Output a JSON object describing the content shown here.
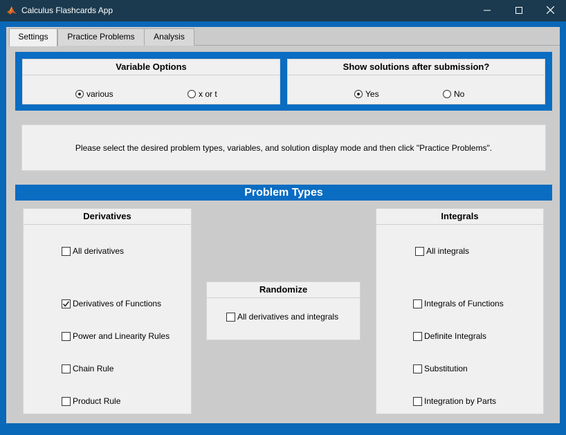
{
  "window": {
    "title": "Calculus Flashcards App",
    "minimize": "—",
    "maximize": "☐",
    "close": "✕"
  },
  "tabs": [
    {
      "label": "Settings",
      "active": true
    },
    {
      "label": "Practice Problems",
      "active": false
    },
    {
      "label": "Analysis",
      "active": false
    }
  ],
  "variable_options": {
    "title": "Variable Options",
    "options": [
      {
        "label": "various",
        "selected": true
      },
      {
        "label": "x or t",
        "selected": false
      }
    ]
  },
  "show_solutions": {
    "title": "Show solutions after submission?",
    "options": [
      {
        "label": "Yes",
        "selected": true
      },
      {
        "label": "No",
        "selected": false
      }
    ]
  },
  "instructions": "Please select the desired problem types, variables, and solution display mode and then click \"Practice Problems\".",
  "problem_types": {
    "title": "Problem Types",
    "derivatives": {
      "title": "Derivatives",
      "items": [
        {
          "label": "All derivatives",
          "checked": false
        },
        {
          "label": "Derivatives of Functions",
          "checked": true
        },
        {
          "label": "Power and Linearity Rules",
          "checked": false
        },
        {
          "label": "Chain Rule",
          "checked": false
        },
        {
          "label": "Product Rule",
          "checked": false
        }
      ]
    },
    "randomize": {
      "title": "Randomize",
      "items": [
        {
          "label": "All derivatives and integrals",
          "checked": false
        }
      ]
    },
    "integrals": {
      "title": "Integrals",
      "items": [
        {
          "label": "All integrals",
          "checked": false
        },
        {
          "label": "Integrals of Functions",
          "checked": false
        },
        {
          "label": "Definite Integrals",
          "checked": false
        },
        {
          "label": "Substitution",
          "checked": false
        },
        {
          "label": "Integration by Parts",
          "checked": false
        }
      ]
    }
  },
  "colors": {
    "accent": "#0a6dc2",
    "titlebar": "#1b3a4f",
    "background": "#cbcbcb",
    "panel": "#f0f0f0"
  },
  "icons": {
    "app": "matlab-logo-icon",
    "radio_on": "●",
    "check_on": "✓"
  }
}
